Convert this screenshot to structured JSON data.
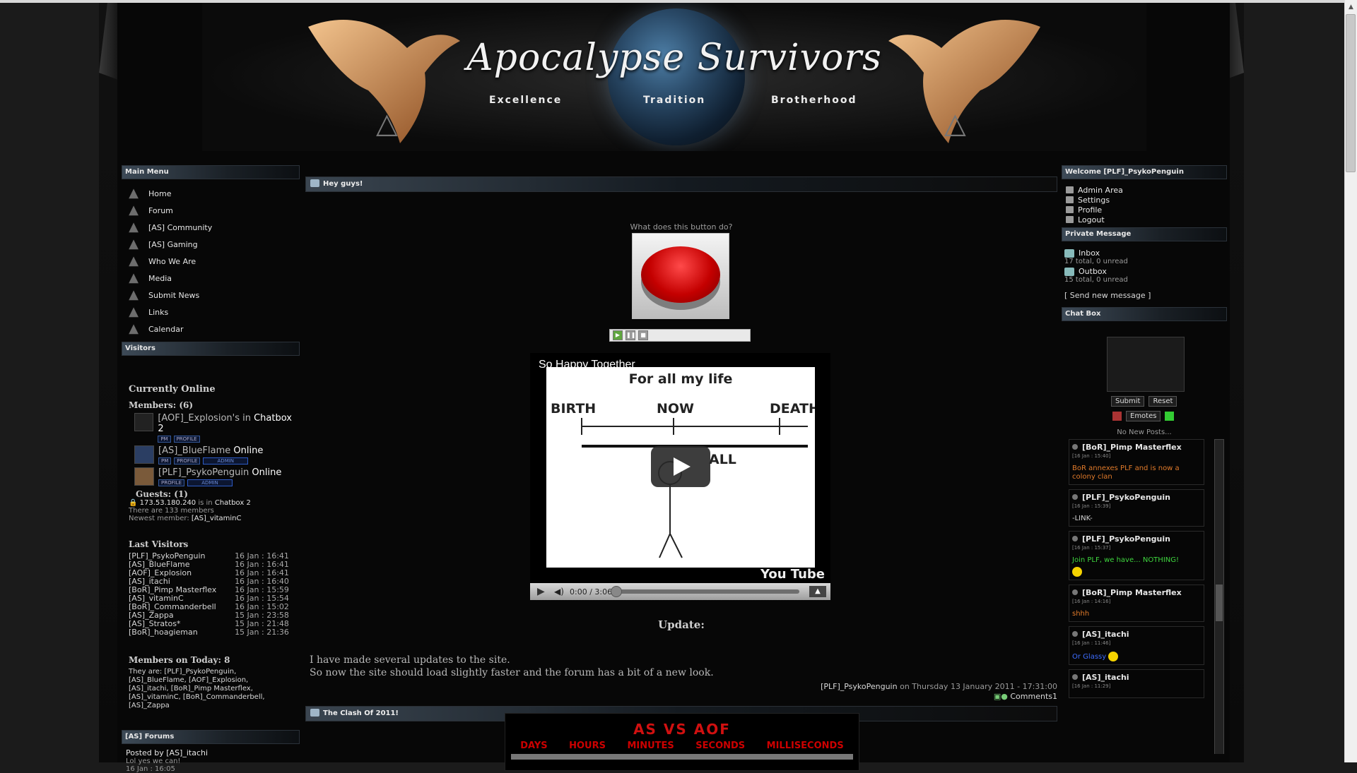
{
  "site": {
    "title": "Apocalypse Survivors",
    "mottos": [
      "Excellence",
      "Tradition",
      "Brotherhood"
    ]
  },
  "left": {
    "main_menu_title": "Main Menu",
    "menu": [
      {
        "label": "Home",
        "icon": "as-logo-icon"
      },
      {
        "label": "Forum",
        "icon": "as-logo-icon"
      },
      {
        "label": "[AS] Community",
        "icon": "as-logo-icon"
      },
      {
        "label": "[AS] Gaming",
        "icon": "as-logo-icon"
      },
      {
        "label": "Who We Are",
        "icon": "as-logo-icon"
      },
      {
        "label": "Media",
        "icon": "as-logo-icon"
      },
      {
        "label": "Submit News",
        "icon": "as-logo-icon"
      },
      {
        "label": "Links",
        "icon": "as-logo-icon"
      },
      {
        "label": "Calendar",
        "icon": "as-logo-icon"
      }
    ],
    "visitors_title": "Visitors",
    "currently_online": "Currently Online",
    "members_label": "Members: (6)",
    "online_members": [
      {
        "name": "[AOF]_Explosion's",
        "status_pre": " in ",
        "status": "Chatbox 2",
        "badges": [
          "PM",
          "PROFILE"
        ],
        "admin": false
      },
      {
        "name": "[AS]_BlueFlame",
        "status_pre": " ",
        "status": "Online",
        "badges": [
          "PM",
          "PROFILE"
        ],
        "admin": true
      },
      {
        "name": "[PLF]_PsykoPenguin",
        "status_pre": " ",
        "status": "Online",
        "badges": [
          "PROFILE"
        ],
        "admin": true
      }
    ],
    "admin_badge": "ADMIN",
    "guests_label": "Guests: (1)",
    "guest_ip": "173.53.180.240",
    "guest_is_in": "is in",
    "guest_where": "Chatbox 2",
    "members_count": "There are 133 members",
    "newest_label": "Newest member:",
    "newest_member": "[AS]_vitaminC",
    "last_visitors_title": "Last Visitors",
    "last_visitors": [
      {
        "name": "[PLF]_PsykoPenguin",
        "time": "16 Jan : 16:41"
      },
      {
        "name": "[AS]_BlueFlame",
        "time": "16 Jan : 16:41"
      },
      {
        "name": "[AOF]_Explosion",
        "time": "16 Jan : 16:41"
      },
      {
        "name": "[AS]_itachi",
        "time": "16 Jan : 16:40"
      },
      {
        "name": "[BoR]_Pimp Masterflex",
        "time": "16 Jan : 15:59"
      },
      {
        "name": "[AS]_vitaminC",
        "time": "16 Jan : 15:54"
      },
      {
        "name": "[BoR]_Commanderbell",
        "time": "16 Jan : 15:02"
      },
      {
        "name": "[AS]_Zappa",
        "time": "15 Jan : 23:58"
      },
      {
        "name": "[AS]_Stratos*",
        "time": "15 Jan : 21:48"
      },
      {
        "name": "[BoR]_hoagieman",
        "time": "15 Jan : 21:36"
      }
    ],
    "members_today_title": "Members on Today: 8",
    "they_are": "They are: [PLF]_PsykoPenguin, [AS]_BlueFlame, [AOF]_Explosion, [AS]_itachi, [BoR]_Pimp Masterflex, [AS]_vitaminC, [BoR]_Commanderbell, [AS]_Zappa",
    "forums_title": "[AS] Forums",
    "forums_post": "Posted by [AS]_itachi",
    "forums_snippet": "Lol yes we can!",
    "forums_time": "16 Jan : 16:05"
  },
  "main": {
    "post1": {
      "title": "Hey guys!",
      "question": "What does this button do?",
      "video_title": "So Happy Together",
      "video_drawing": {
        "heading": "For all my life",
        "labels": [
          "BIRTH",
          "NOW",
          "DEATH",
          "ALL"
        ]
      },
      "video_time": "0:00 / 3:06",
      "youtube": "You Tube",
      "update_heading": "Update:",
      "update_line1": "I have made several updates to the site.",
      "update_line2": "So now the site should load slightly faster and the forum has a bit of a new look.",
      "author": "[PLF]_PsykoPenguin",
      "on": "on",
      "date": "Thursday 13 January 2011 - 17:31:00",
      "comments": "Comments1"
    },
    "post2": {
      "title": "The Clash Of 2011!",
      "countdown_title": "AS VS AOF",
      "countdown_labels": [
        "DAYS",
        "HOURS",
        "MINUTES",
        "SECONDS",
        "MILLISECONDS"
      ]
    }
  },
  "right": {
    "welcome_title": "Welcome [PLF]_PsykoPenguin",
    "user_links": [
      "Admin Area",
      "Settings",
      "Profile",
      "Logout"
    ],
    "pm_title": "Private Message",
    "inbox": "Inbox",
    "inbox_count": "17 total, 0 unread",
    "outbox": "Outbox",
    "outbox_count": "15 total, 0 unread",
    "send": "[ Send new message ]",
    "chat_title": "Chat Box",
    "submit": "Submit",
    "reset": "Reset",
    "emotes": "Emotes",
    "no_new": "No New Posts...",
    "messages": [
      {
        "user": "[BoR]_Pimp Masterflex",
        "date": "[16 Jan : 15:40]",
        "text": "BoR annexes PLF and is now a colony clan",
        "color": "#e07a2a"
      },
      {
        "user": "[PLF]_PsykoPenguin",
        "date": "[16 Jan : 15:39]",
        "text": "-LINK-",
        "color": "#d6d6d6"
      },
      {
        "user": "[PLF]_PsykoPenguin",
        "date": "[16 Jan : 15:37]",
        "text": "Join PLF, we have... NOTHING!",
        "color": "#3fd63f"
      },
      {
        "user": "[BoR]_Pimp Masterflex",
        "date": "[16 Jan : 14:16]",
        "text": "shhh",
        "color": "#e07a2a"
      },
      {
        "user": "[AS]_itachi",
        "date": "[16 Jan : 11:46]",
        "text": "Or Glassy",
        "color": "#3d6dff"
      },
      {
        "user": "[AS]_itachi",
        "date": "[16 Jan : 11:29]",
        "text": "",
        "color": "#d6d6d6"
      }
    ]
  }
}
